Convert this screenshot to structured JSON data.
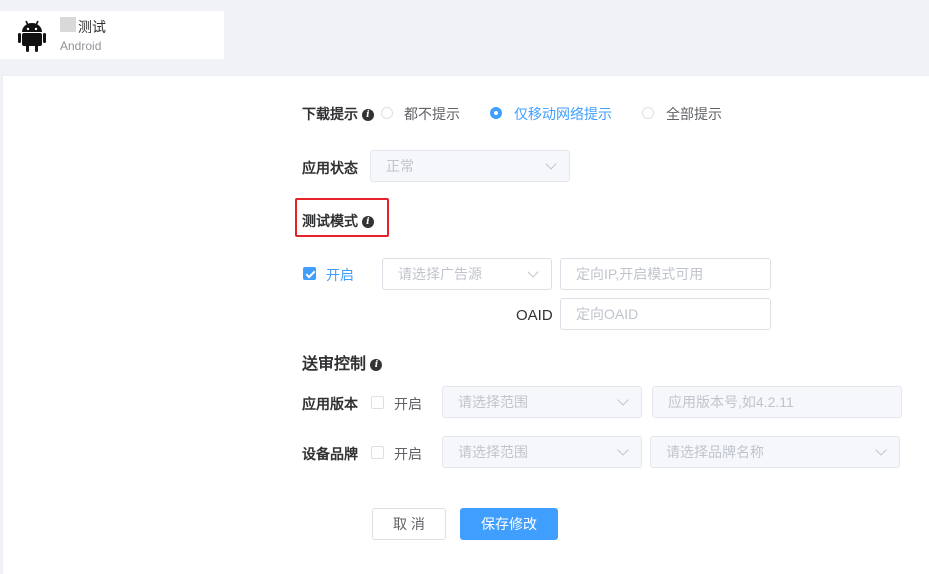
{
  "app": {
    "name": "测试",
    "platform": "Android"
  },
  "download_tip": {
    "label": "下载提示",
    "options": [
      "都不提示",
      "仅移动网络提示",
      "全部提示"
    ],
    "selected_index": 1
  },
  "app_status": {
    "label": "应用状态",
    "value": "正常"
  },
  "test_mode": {
    "label": "测试模式",
    "enabled_label": "开启",
    "enabled": true,
    "ad_source_placeholder": "请选择广告源",
    "ip_placeholder": "定向IP,开启模式可用",
    "oaid_label": "OAID",
    "oaid_placeholder": "定向OAID"
  },
  "review_control": {
    "title": "送审控制",
    "app_version": {
      "label": "应用版本",
      "enabled_label": "开启",
      "range_placeholder": "请选择范围",
      "version_placeholder": "应用版本号,如4.2.11"
    },
    "device_brand": {
      "label": "设备品牌",
      "enabled_label": "开启",
      "range_placeholder": "请选择范围",
      "brand_placeholder": "请选择品牌名称"
    }
  },
  "actions": {
    "cancel": "取 消",
    "save": "保存修改"
  },
  "colors": {
    "primary": "#409eff",
    "highlight": "#e6212a"
  }
}
